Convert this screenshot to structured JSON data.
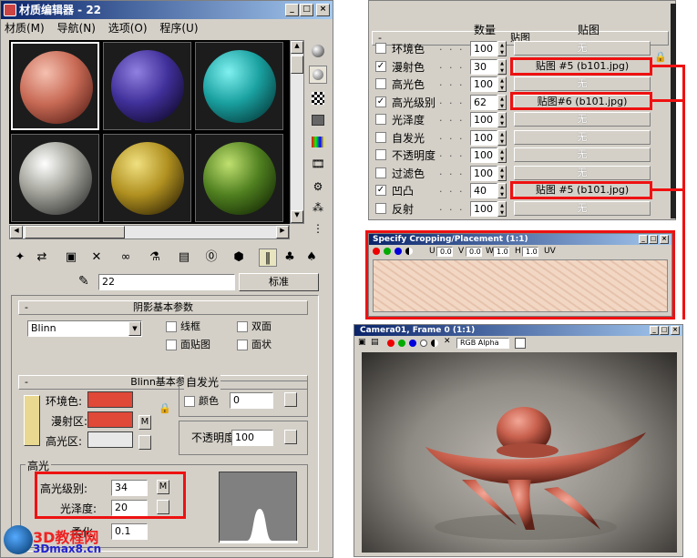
{
  "mat_editor": {
    "title": "材质编辑器 - 22",
    "menu": [
      "材质(M)",
      "导航(N)",
      "选项(O)",
      "程序(U)"
    ],
    "material_name": "22",
    "type_button": "标准",
    "shader_rollout": "阴影基本参数",
    "shader_type": "Blinn",
    "wireframe": "线框",
    "two_sided": "双面",
    "face_map": "面贴图",
    "faceted": "面状",
    "blinn_rollout": "Blinn基本参数",
    "self_illum": "自发光",
    "color_label": "颜色",
    "self_illum_value": "0",
    "ambient": "环境色:",
    "diffuse": "漫射区:",
    "specular": "高光区:",
    "opacity": "不透明度",
    "opacity_value": "100",
    "highlight_group": "高光",
    "spec_level_label": "高光级别:",
    "spec_level_value": "34",
    "gloss_label": "光泽度:",
    "gloss_value": "20",
    "soften_label": "柔化",
    "soften_value": "0.1",
    "m_label": "M",
    "colors": {
      "ambient": "#e04838",
      "diffuse": "#e04838",
      "specular": "#e8e8e8"
    }
  },
  "maps": {
    "title": "贴图",
    "col_amount": "数量",
    "col_map": "贴图",
    "rows": [
      {
        "name": "环境色",
        "checked": false,
        "amount": "100",
        "map": "无"
      },
      {
        "name": "漫射色",
        "checked": true,
        "amount": "30",
        "map": "贴图 #5 (b101.jpg)"
      },
      {
        "name": "高光色",
        "checked": false,
        "amount": "100",
        "map": "无"
      },
      {
        "name": "高光级别",
        "checked": true,
        "amount": "62",
        "map": "贴图#6 (b101.jpg)"
      },
      {
        "name": "光泽度",
        "checked": false,
        "amount": "100",
        "map": "无"
      },
      {
        "name": "自发光",
        "checked": false,
        "amount": "100",
        "map": "无"
      },
      {
        "name": "不透明度",
        "checked": false,
        "amount": "100",
        "map": "无"
      },
      {
        "name": "过滤色",
        "checked": false,
        "amount": "100",
        "map": "无"
      },
      {
        "name": "凹凸",
        "checked": true,
        "amount": "40",
        "map": "贴图 #5 (b101.jpg)"
      },
      {
        "name": "反射",
        "checked": false,
        "amount": "100",
        "map": "无"
      }
    ]
  },
  "crop": {
    "title": "Specify Cropping/Placement (1:1)",
    "u_label": "U",
    "u_value": "0.0",
    "v_label": "V",
    "v_value": "0.0",
    "w_label": "W",
    "w_value": "1.0",
    "h_label": "H",
    "h_value": "1.0",
    "uv_label": "UV"
  },
  "render": {
    "title": "Camera01, Frame 0 (1:1)",
    "channel": "RGB Alpha"
  },
  "watermark": {
    "site": "3D教程网",
    "url": "3Dmax8.cn"
  }
}
